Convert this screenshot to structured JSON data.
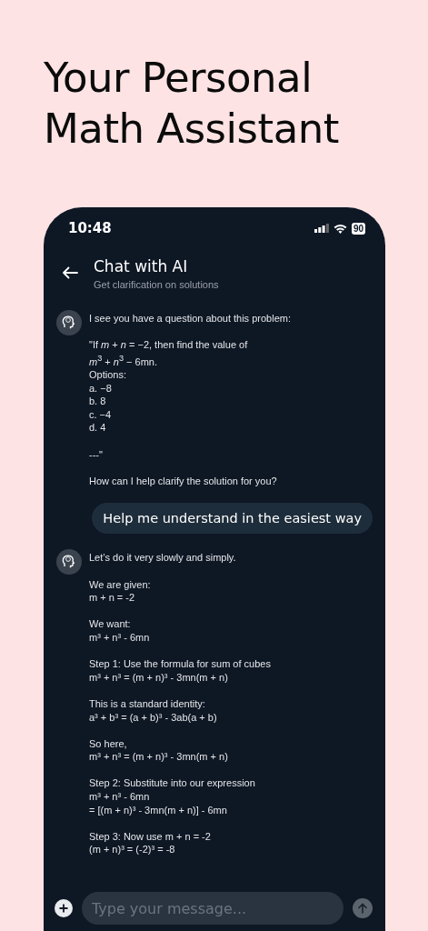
{
  "headline": [
    "Your Personal",
    "Math Assistant"
  ],
  "status_bar": {
    "time": "10:48",
    "battery": "90"
  },
  "header": {
    "title": "Chat with AI",
    "subtitle": "Get clarification on solutions"
  },
  "messages": [
    {
      "kind": "ai",
      "blocks": [
        [
          "I see you have a question about this problem:"
        ],
        [
          "\"If *m* + *n* = −2, then find the value of",
          "*m*$^{3}$ + *n*$^{3}$ − 6mn.",
          "Options:",
          "a. −8",
          "b. 8",
          "c. −4",
          "d. 4"
        ],
        [
          "---\""
        ],
        [
          "How can I help clarify the solution for you?"
        ]
      ]
    },
    {
      "kind": "user",
      "text": "Help me understand in the easiest way"
    },
    {
      "kind": "ai",
      "blocks": [
        [
          "Let’s do it very slowly and simply."
        ],
        [
          "We are given:",
          "m + n = -2"
        ],
        [
          "We want:",
          "m³ + n³ - 6mn"
        ],
        [
          "Step 1: Use the formula for sum of cubes",
          "m³ + n³ = (m + n)³ - 3mn(m + n)"
        ],
        [
          "This is a standard identity:",
          "a³ + b³ = (a + b)³ - 3ab(a + b)"
        ],
        [
          "So here,",
          "m³ + n³ = (m + n)³ - 3mn(m + n)"
        ],
        [
          "Step 2: Substitute into our expression",
          "m³ + n³ - 6mn",
          "= [(m + n)³ - 3mn(m + n)] - 6mn"
        ],
        [
          "Step 3: Now use m + n = -2",
          "(m + n)³ = (-2)³ = -8"
        ]
      ]
    }
  ],
  "composer": {
    "placeholder": "Type your message..."
  }
}
